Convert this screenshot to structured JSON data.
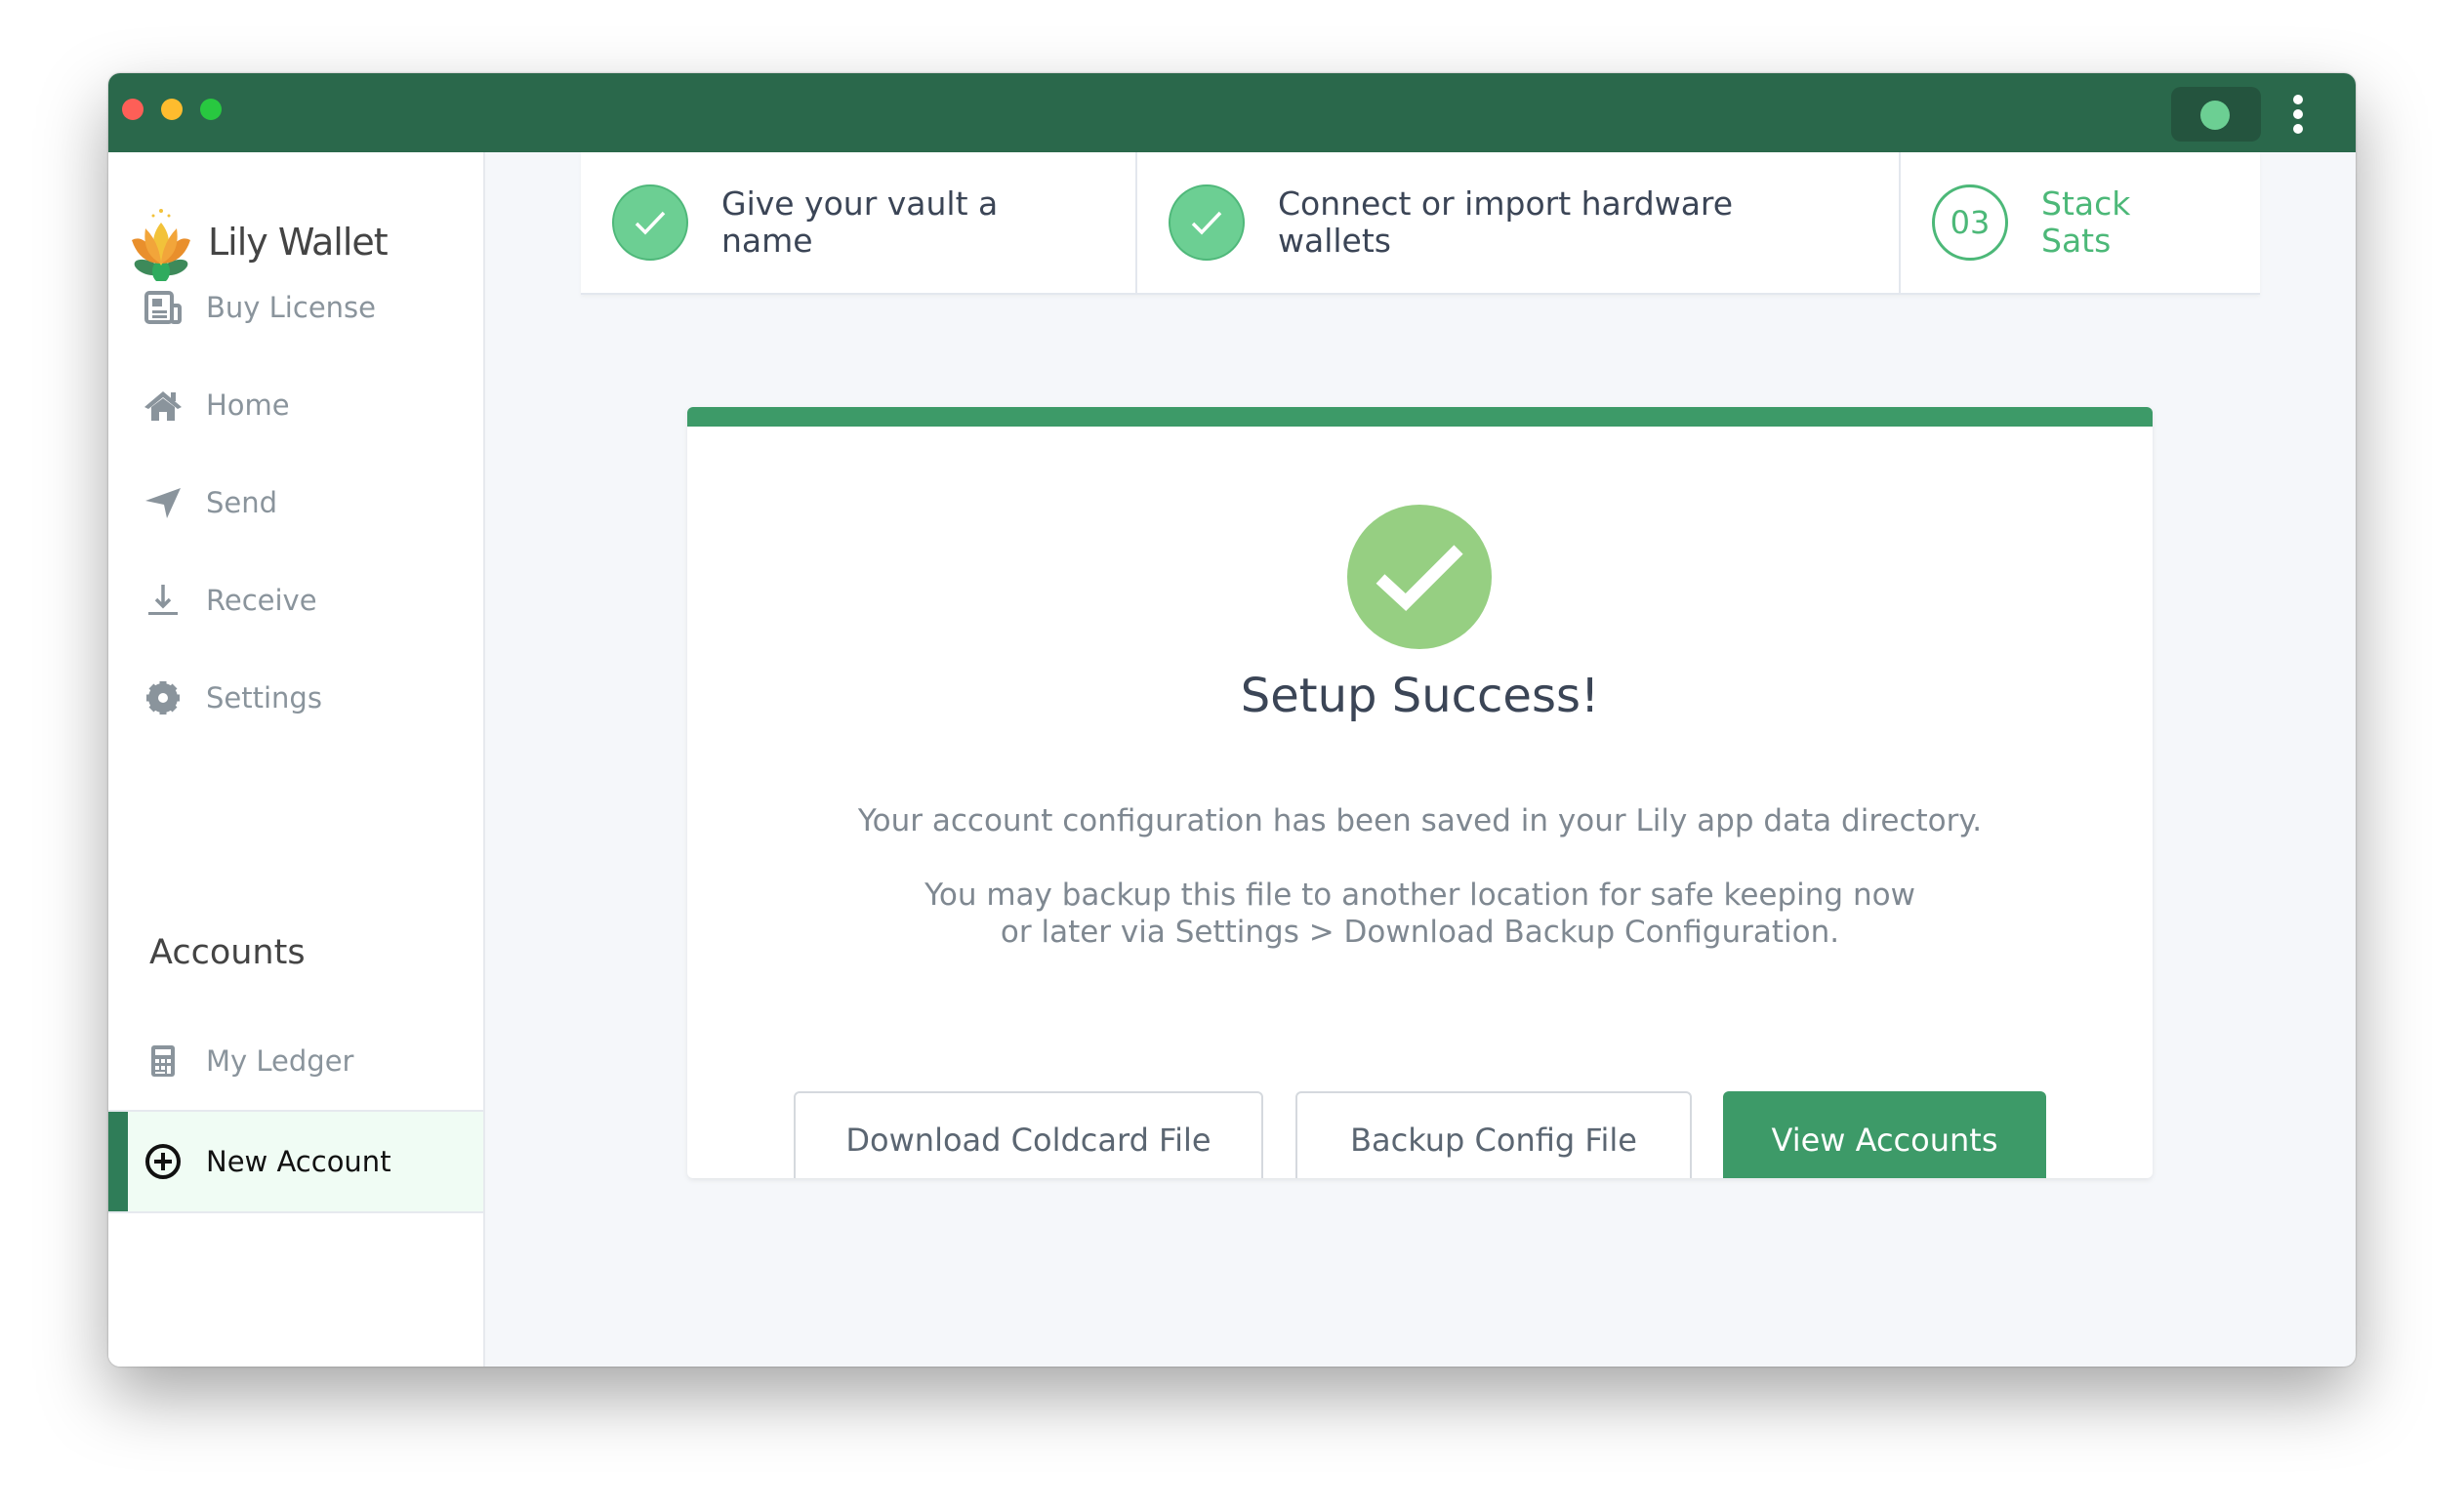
{
  "window": {
    "controls": [
      "close",
      "minimize",
      "maximize"
    ],
    "status_color": "#6ccf93",
    "menu_icon": "kebab-icon"
  },
  "colors": {
    "titlebar": "#2a684b",
    "accent": "#3d9a68",
    "success": "#96cf82"
  },
  "sidebar": {
    "brand": "Lily Wallet",
    "items": [
      {
        "label": "Buy License",
        "icon": "license-icon"
      },
      {
        "label": "Home",
        "icon": "home-icon"
      },
      {
        "label": "Send",
        "icon": "send-icon"
      },
      {
        "label": "Receive",
        "icon": "receive-icon"
      },
      {
        "label": "Settings",
        "icon": "gear-icon"
      }
    ],
    "accounts_heading": "Accounts",
    "accounts": [
      {
        "label": "My Ledger",
        "icon": "calculator-icon"
      },
      {
        "label": "New Account",
        "icon": "plus-circle-icon",
        "active": true
      }
    ]
  },
  "stepper": {
    "steps": [
      {
        "label": "Give your vault a name",
        "status": "complete"
      },
      {
        "label": "Connect or import hardware wallets",
        "status": "complete"
      },
      {
        "number": "03",
        "label": "Stack Sats",
        "status": "current"
      }
    ]
  },
  "main": {
    "title": "Setup Success!",
    "message1": "Your account configuration has been saved in your Lily app data directory.",
    "message2a": "You may backup this file to another location for safe keeping now",
    "message2b": "or later via Settings > Download Backup Configuration.",
    "buttons": {
      "download": "Download Coldcard File",
      "backup": "Backup Config File",
      "view": "View Accounts"
    }
  }
}
